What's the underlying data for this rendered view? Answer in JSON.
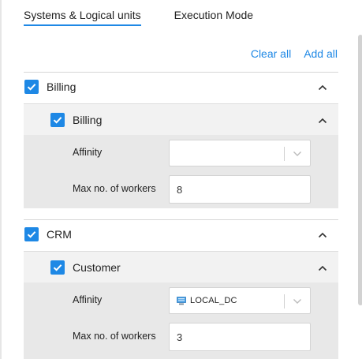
{
  "tabs": [
    {
      "label": "Systems & Logical units",
      "active": true
    },
    {
      "label": "Execution Mode",
      "active": false
    }
  ],
  "actions": {
    "clear_all": "Clear all",
    "add_all": "Add all"
  },
  "groups": [
    {
      "label": "Billing",
      "checked": true,
      "units": [
        {
          "label": "Billing",
          "checked": true,
          "affinity_label": "Affinity",
          "affinity_value": "",
          "workers_label": "Max no. of workers",
          "workers_value": "8"
        }
      ]
    },
    {
      "label": "CRM",
      "checked": true,
      "units": [
        {
          "label": "Customer",
          "checked": true,
          "affinity_label": "Affinity",
          "affinity_value": "LOCAL_DC",
          "affinity_icon": "datacenter-icon",
          "workers_label": "Max no. of workers",
          "workers_value": "3"
        }
      ]
    }
  ],
  "colors": {
    "accent": "#1e88e5",
    "sub_row": "#f2f2f2",
    "detail_bg": "#e8e8e8"
  }
}
